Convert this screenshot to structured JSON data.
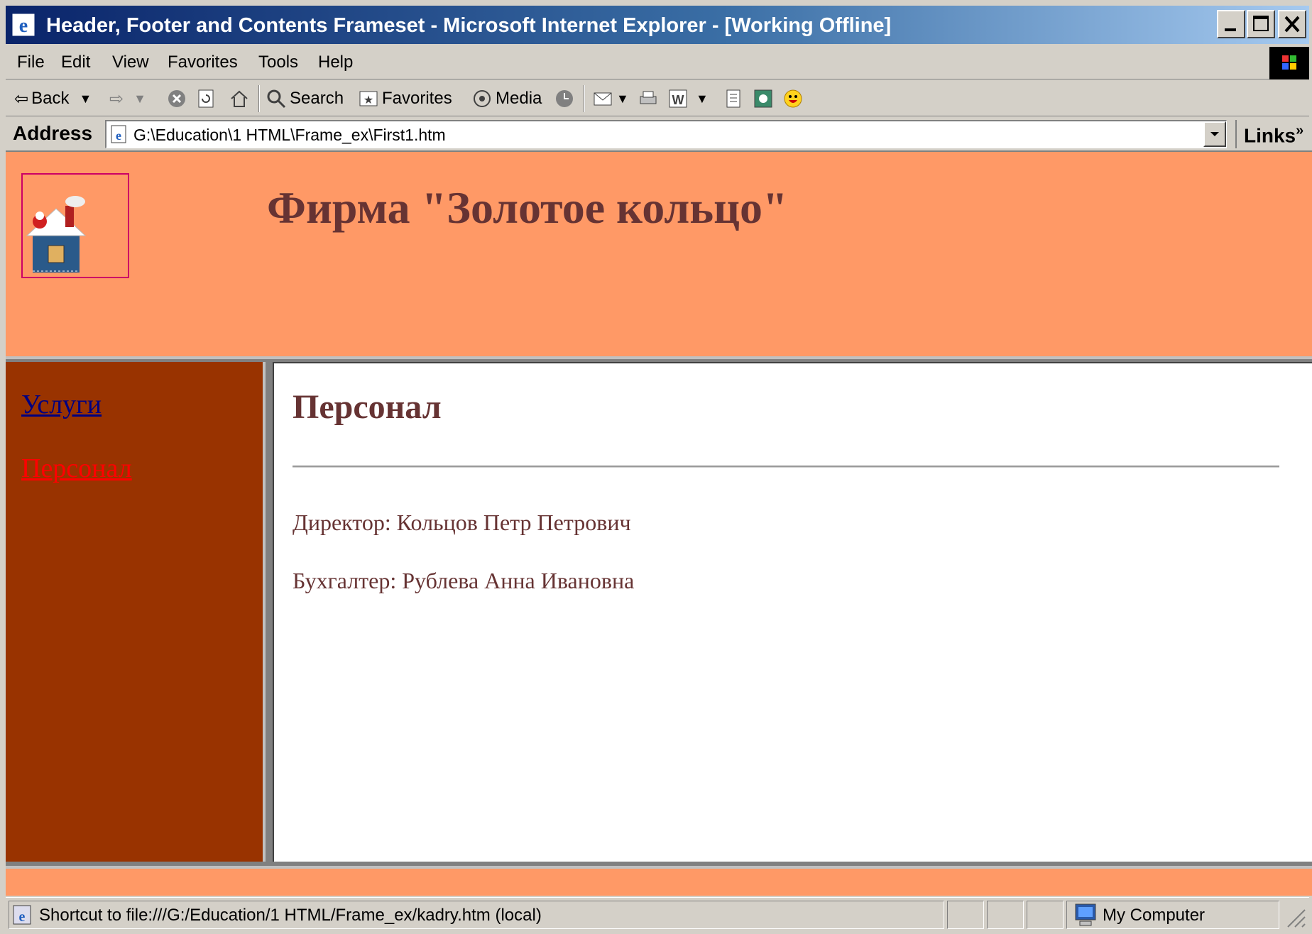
{
  "window": {
    "title": "Header, Footer and Contents Frameset - Microsoft Internet Explorer - [Working Offline]"
  },
  "menu": [
    "File",
    "Edit",
    "View",
    "Favorites",
    "Tools",
    "Help"
  ],
  "toolbar": {
    "back": "Back",
    "search": "Search",
    "favorites": "Favorites",
    "media": "Media"
  },
  "address": {
    "label": "Address",
    "value": "G:\\Education\\1 HTML\\Frame_ex\\First1.htm",
    "links": "Links"
  },
  "header_frame": {
    "company": "Фирма \"Золотое кольцо\""
  },
  "nav_frame": {
    "links": [
      "Услуги",
      "Персонал"
    ]
  },
  "main_frame": {
    "heading": "Персонал",
    "staff": [
      "Директор: Кольцов Петр Петрович",
      "Бухгалтер: Рублева Анна Ивановна"
    ]
  },
  "status": {
    "text": "Shortcut to file:///G:/Education/1 HTML/Frame_ex/kadry.htm (local)",
    "zone": "My Computer"
  },
  "colors": {
    "header_bg": "#ff9966",
    "nav_bg": "#993300",
    "text_brown": "#663333",
    "link_visited": "#000080",
    "link_active": "#ff0000"
  }
}
